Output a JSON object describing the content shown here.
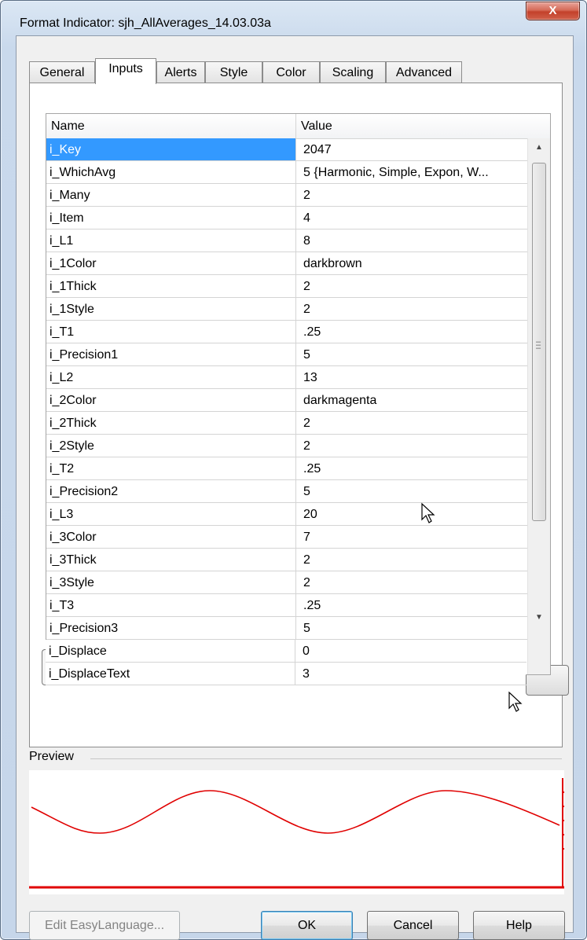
{
  "window": {
    "title": "Format Indicator: sjh_AllAverages_14.03.03a",
    "close_label": "X"
  },
  "tabs": [
    {
      "label": "General"
    },
    {
      "label": "Inputs",
      "active": true
    },
    {
      "label": "Alerts"
    },
    {
      "label": "Style"
    },
    {
      "label": "Color"
    },
    {
      "label": "Scaling"
    },
    {
      "label": "Advanced"
    }
  ],
  "grid": {
    "columns": {
      "name": "Name",
      "value": "Value"
    },
    "selected_row": "i_Key",
    "rows": [
      {
        "name": "i_Key",
        "value": "2047"
      },
      {
        "name": "i_WhichAvg",
        "value": "5 {Harmonic, Simple, Expon, W..."
      },
      {
        "name": "i_Many",
        "value": "2"
      },
      {
        "name": "i_Item",
        "value": "4"
      },
      {
        "name": "i_L1",
        "value": "8"
      },
      {
        "name": "i_1Color",
        "value": "darkbrown"
      },
      {
        "name": "i_1Thick",
        "value": "2"
      },
      {
        "name": "i_1Style",
        "value": "2"
      },
      {
        "name": "i_T1",
        "value": ".25"
      },
      {
        "name": "i_Precision1",
        "value": "5"
      },
      {
        "name": "i_L2",
        "value": "13"
      },
      {
        "name": "i_2Color",
        "value": "darkmagenta"
      },
      {
        "name": "i_2Thick",
        "value": "2"
      },
      {
        "name": "i_2Style",
        "value": "2"
      },
      {
        "name": "i_T2",
        "value": ".25"
      },
      {
        "name": "i_Precision2",
        "value": "5"
      },
      {
        "name": "i_L3",
        "value": "20"
      },
      {
        "name": "i_3Color",
        "value": "7"
      },
      {
        "name": "i_3Thick",
        "value": "2"
      },
      {
        "name": "i_3Style",
        "value": "2"
      },
      {
        "name": "i_T3",
        "value": ".25"
      },
      {
        "name": "i_Precision3",
        "value": "5"
      }
    ],
    "overflow_rows": [
      {
        "name": "i_Displace",
        "value": "0"
      },
      {
        "name": "i_DisplaceText",
        "value": "3"
      }
    ]
  },
  "preview": {
    "label": "Preview",
    "line_color": "#e00000"
  },
  "buttons": {
    "edit_easylanguage": "Edit EasyLanguage...",
    "ok": "OK",
    "cancel": "Cancel",
    "help": "Help"
  },
  "icons": {
    "close": "close-icon",
    "scroll_up": "scroll-up-arrow-icon",
    "scroll_down": "scroll-down-arrow-icon",
    "cursor": "mouse-pointer-icon"
  },
  "colors": {
    "selection": "#3399ff",
    "title_bar": "#c9d9ec",
    "close_button": "#c3412b"
  }
}
